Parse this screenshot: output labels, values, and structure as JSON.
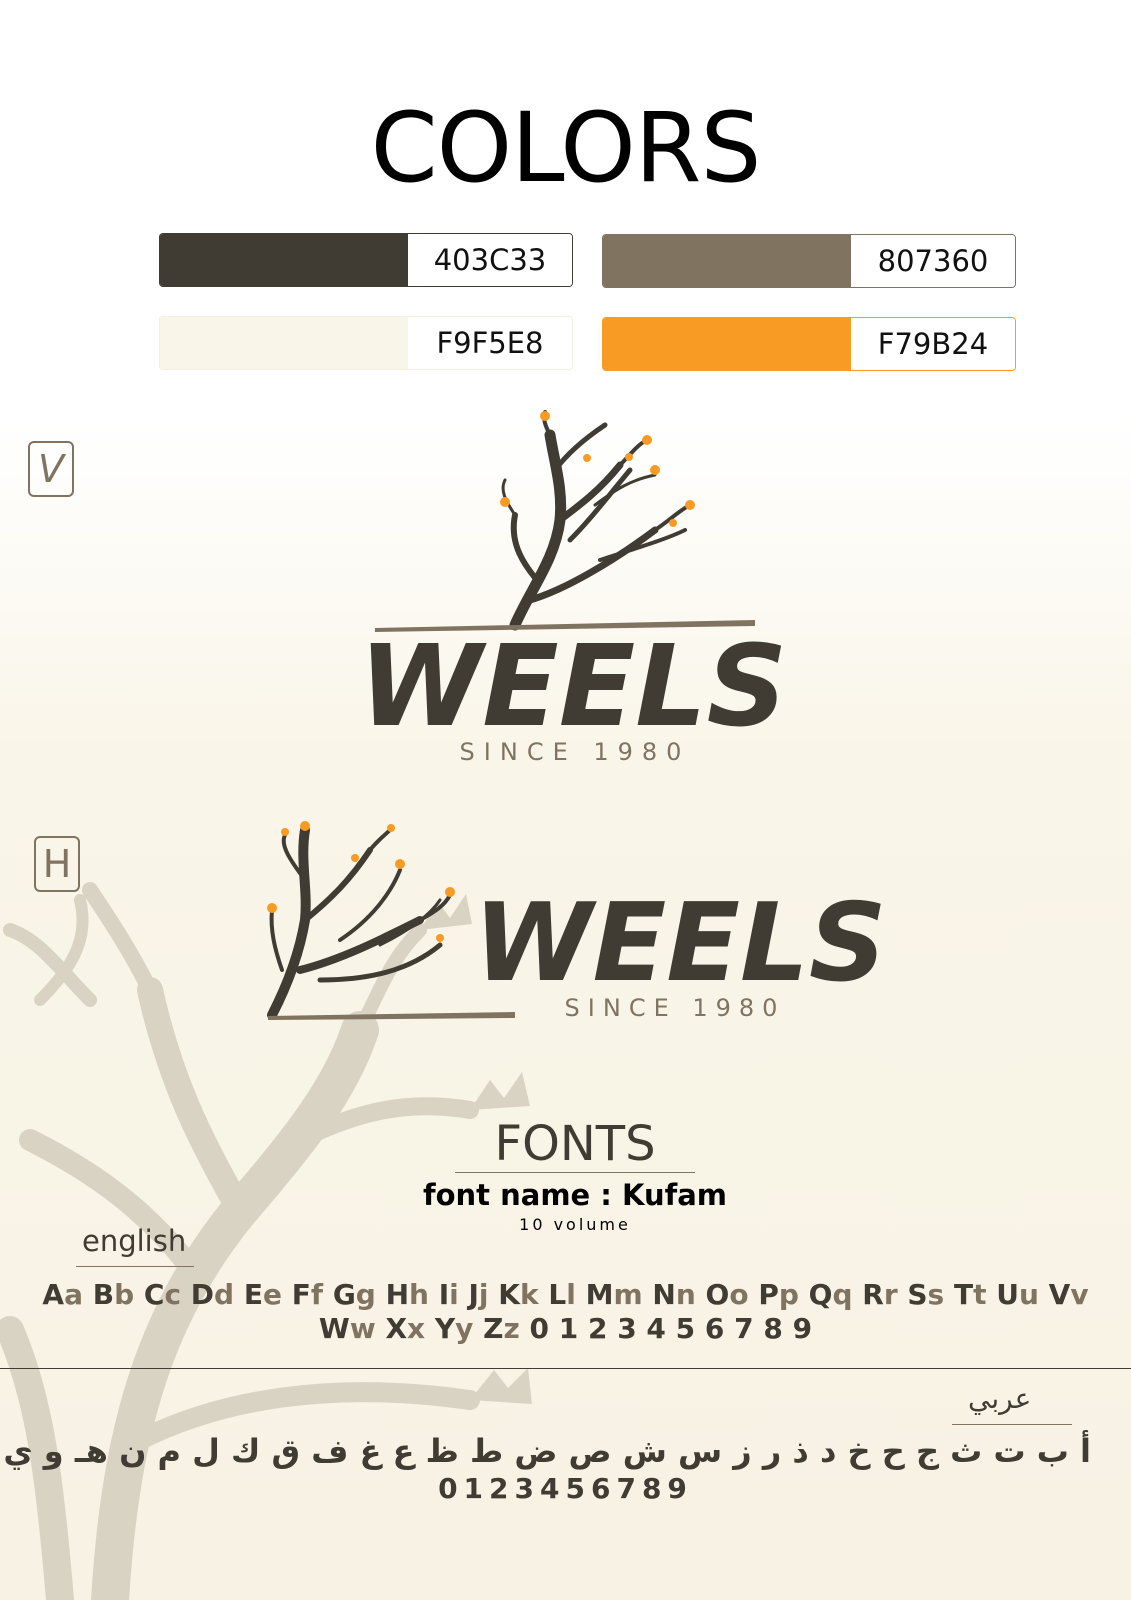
{
  "colors_section": {
    "title": "COLORS",
    "swatches": [
      {
        "hex": "#403C33",
        "code": "403C33"
      },
      {
        "hex": "#807360",
        "code": "807360"
      },
      {
        "hex": "#F9F5E8",
        "code": "F9F5E8"
      },
      {
        "hex": "#F79B24",
        "code": "F79B24"
      }
    ]
  },
  "logos": {
    "vertical_badge": "V",
    "horizontal_badge": "H",
    "wordmark": "WEELS",
    "tagline": "SINCE 1980"
  },
  "fonts_section": {
    "title": "FONTS",
    "font_name": "font name : Kufam",
    "volume": "10 volume",
    "english_label": "english",
    "english_row1": [
      [
        "A",
        "a"
      ],
      [
        "B",
        "b"
      ],
      [
        "C",
        "c"
      ],
      [
        "D",
        "d"
      ],
      [
        "E",
        "e"
      ],
      [
        "F",
        "f"
      ],
      [
        "G",
        "g"
      ],
      [
        "H",
        "h"
      ],
      [
        "I",
        "i"
      ],
      [
        "J",
        "j"
      ],
      [
        "K",
        "k"
      ],
      [
        "L",
        "l"
      ],
      [
        "M",
        "m"
      ],
      [
        "N",
        "n"
      ],
      [
        "O",
        "o"
      ],
      [
        "P",
        "p"
      ],
      [
        "Q",
        "q"
      ],
      [
        "R",
        "r"
      ],
      [
        "S",
        "s"
      ],
      [
        "T",
        "t"
      ],
      [
        "U",
        "u"
      ],
      [
        "V",
        "v"
      ]
    ],
    "english_row2_pairs": [
      [
        "W",
        "w"
      ],
      [
        "X",
        "x"
      ],
      [
        "Y",
        "y"
      ],
      [
        "Z",
        "z"
      ]
    ],
    "english_digits": "0 1 2 3 4 5 6 7 8 9",
    "arabic_label": "عربي",
    "arabic_letters": "أ ب ت ث ج ح خ د ذ ر ز س ش ص ض ط ظ ع غ ف ق ك ل م ن هـ و ي",
    "arabic_digits": "0123456789"
  }
}
